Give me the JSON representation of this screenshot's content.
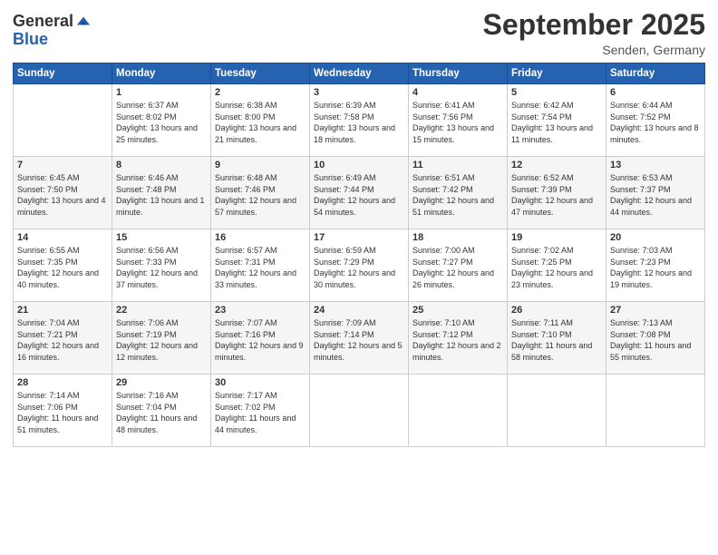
{
  "logo": {
    "general": "General",
    "blue": "Blue"
  },
  "header": {
    "month_title": "September 2025",
    "location": "Senden, Germany"
  },
  "weekdays": [
    "Sunday",
    "Monday",
    "Tuesday",
    "Wednesday",
    "Thursday",
    "Friday",
    "Saturday"
  ],
  "weeks": [
    [
      {
        "day": "",
        "sunrise": "",
        "sunset": "",
        "daylight": ""
      },
      {
        "day": "1",
        "sunrise": "Sunrise: 6:37 AM",
        "sunset": "Sunset: 8:02 PM",
        "daylight": "Daylight: 13 hours and 25 minutes."
      },
      {
        "day": "2",
        "sunrise": "Sunrise: 6:38 AM",
        "sunset": "Sunset: 8:00 PM",
        "daylight": "Daylight: 13 hours and 21 minutes."
      },
      {
        "day": "3",
        "sunrise": "Sunrise: 6:39 AM",
        "sunset": "Sunset: 7:58 PM",
        "daylight": "Daylight: 13 hours and 18 minutes."
      },
      {
        "day": "4",
        "sunrise": "Sunrise: 6:41 AM",
        "sunset": "Sunset: 7:56 PM",
        "daylight": "Daylight: 13 hours and 15 minutes."
      },
      {
        "day": "5",
        "sunrise": "Sunrise: 6:42 AM",
        "sunset": "Sunset: 7:54 PM",
        "daylight": "Daylight: 13 hours and 11 minutes."
      },
      {
        "day": "6",
        "sunrise": "Sunrise: 6:44 AM",
        "sunset": "Sunset: 7:52 PM",
        "daylight": "Daylight: 13 hours and 8 minutes."
      }
    ],
    [
      {
        "day": "7",
        "sunrise": "Sunrise: 6:45 AM",
        "sunset": "Sunset: 7:50 PM",
        "daylight": "Daylight: 13 hours and 4 minutes."
      },
      {
        "day": "8",
        "sunrise": "Sunrise: 6:46 AM",
        "sunset": "Sunset: 7:48 PM",
        "daylight": "Daylight: 13 hours and 1 minute."
      },
      {
        "day": "9",
        "sunrise": "Sunrise: 6:48 AM",
        "sunset": "Sunset: 7:46 PM",
        "daylight": "Daylight: 12 hours and 57 minutes."
      },
      {
        "day": "10",
        "sunrise": "Sunrise: 6:49 AM",
        "sunset": "Sunset: 7:44 PM",
        "daylight": "Daylight: 12 hours and 54 minutes."
      },
      {
        "day": "11",
        "sunrise": "Sunrise: 6:51 AM",
        "sunset": "Sunset: 7:42 PM",
        "daylight": "Daylight: 12 hours and 51 minutes."
      },
      {
        "day": "12",
        "sunrise": "Sunrise: 6:52 AM",
        "sunset": "Sunset: 7:39 PM",
        "daylight": "Daylight: 12 hours and 47 minutes."
      },
      {
        "day": "13",
        "sunrise": "Sunrise: 6:53 AM",
        "sunset": "Sunset: 7:37 PM",
        "daylight": "Daylight: 12 hours and 44 minutes."
      }
    ],
    [
      {
        "day": "14",
        "sunrise": "Sunrise: 6:55 AM",
        "sunset": "Sunset: 7:35 PM",
        "daylight": "Daylight: 12 hours and 40 minutes."
      },
      {
        "day": "15",
        "sunrise": "Sunrise: 6:56 AM",
        "sunset": "Sunset: 7:33 PM",
        "daylight": "Daylight: 12 hours and 37 minutes."
      },
      {
        "day": "16",
        "sunrise": "Sunrise: 6:57 AM",
        "sunset": "Sunset: 7:31 PM",
        "daylight": "Daylight: 12 hours and 33 minutes."
      },
      {
        "day": "17",
        "sunrise": "Sunrise: 6:59 AM",
        "sunset": "Sunset: 7:29 PM",
        "daylight": "Daylight: 12 hours and 30 minutes."
      },
      {
        "day": "18",
        "sunrise": "Sunrise: 7:00 AM",
        "sunset": "Sunset: 7:27 PM",
        "daylight": "Daylight: 12 hours and 26 minutes."
      },
      {
        "day": "19",
        "sunrise": "Sunrise: 7:02 AM",
        "sunset": "Sunset: 7:25 PM",
        "daylight": "Daylight: 12 hours and 23 minutes."
      },
      {
        "day": "20",
        "sunrise": "Sunrise: 7:03 AM",
        "sunset": "Sunset: 7:23 PM",
        "daylight": "Daylight: 12 hours and 19 minutes."
      }
    ],
    [
      {
        "day": "21",
        "sunrise": "Sunrise: 7:04 AM",
        "sunset": "Sunset: 7:21 PM",
        "daylight": "Daylight: 12 hours and 16 minutes."
      },
      {
        "day": "22",
        "sunrise": "Sunrise: 7:06 AM",
        "sunset": "Sunset: 7:19 PM",
        "daylight": "Daylight: 12 hours and 12 minutes."
      },
      {
        "day": "23",
        "sunrise": "Sunrise: 7:07 AM",
        "sunset": "Sunset: 7:16 PM",
        "daylight": "Daylight: 12 hours and 9 minutes."
      },
      {
        "day": "24",
        "sunrise": "Sunrise: 7:09 AM",
        "sunset": "Sunset: 7:14 PM",
        "daylight": "Daylight: 12 hours and 5 minutes."
      },
      {
        "day": "25",
        "sunrise": "Sunrise: 7:10 AM",
        "sunset": "Sunset: 7:12 PM",
        "daylight": "Daylight: 12 hours and 2 minutes."
      },
      {
        "day": "26",
        "sunrise": "Sunrise: 7:11 AM",
        "sunset": "Sunset: 7:10 PM",
        "daylight": "Daylight: 11 hours and 58 minutes."
      },
      {
        "day": "27",
        "sunrise": "Sunrise: 7:13 AM",
        "sunset": "Sunset: 7:08 PM",
        "daylight": "Daylight: 11 hours and 55 minutes."
      }
    ],
    [
      {
        "day": "28",
        "sunrise": "Sunrise: 7:14 AM",
        "sunset": "Sunset: 7:06 PM",
        "daylight": "Daylight: 11 hours and 51 minutes."
      },
      {
        "day": "29",
        "sunrise": "Sunrise: 7:16 AM",
        "sunset": "Sunset: 7:04 PM",
        "daylight": "Daylight: 11 hours and 48 minutes."
      },
      {
        "day": "30",
        "sunrise": "Sunrise: 7:17 AM",
        "sunset": "Sunset: 7:02 PM",
        "daylight": "Daylight: 11 hours and 44 minutes."
      },
      {
        "day": "",
        "sunrise": "",
        "sunset": "",
        "daylight": ""
      },
      {
        "day": "",
        "sunrise": "",
        "sunset": "",
        "daylight": ""
      },
      {
        "day": "",
        "sunrise": "",
        "sunset": "",
        "daylight": ""
      },
      {
        "day": "",
        "sunrise": "",
        "sunset": "",
        "daylight": ""
      }
    ]
  ]
}
